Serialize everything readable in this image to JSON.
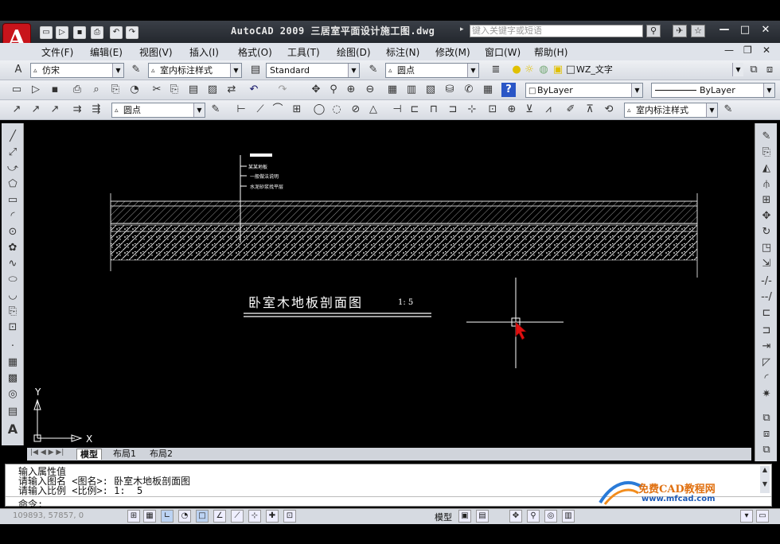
{
  "window": {
    "title": "AutoCAD 2009  三居室平面设计施工图.dwg",
    "search_placeholder": "键入关键字或短语",
    "minimize": "—",
    "restore": "□",
    "close": "✕"
  },
  "app_button": {
    "label": "A"
  },
  "menu": {
    "items": [
      "文件(F)",
      "编辑(E)",
      "视图(V)",
      "插入(I)",
      "格式(O)",
      "工具(T)",
      "绘图(D)",
      "标注(N)",
      "修改(M)",
      "窗口(W)",
      "帮助(H)"
    ]
  },
  "toolbar1": {
    "text_style": "仿宋",
    "dim_style": "室内标注样式",
    "table_style": "Standard",
    "multileader_style": "圆点",
    "layer": "WZ_文字"
  },
  "toolbar2": {
    "color": "ByLayer",
    "linetype": "ByLayer"
  },
  "toolbar3": {
    "multileader_style": "圆点",
    "dim_style": "室内标注样式"
  },
  "drawing": {
    "title": "卧室木地板剖面图",
    "scale": "1:  5",
    "leader_notes": [
      "某某地板",
      "一般做法说明",
      "水泥砂浆找平层"
    ],
    "ucs_x": "X",
    "ucs_y": "Y"
  },
  "tabs": {
    "model": "模型",
    "layout1": "布局1",
    "layout2": "布局2"
  },
  "command": {
    "lines": [
      "输入属性值",
      "请输入图名 <图名>: 卧室木地板剖面图",
      "请输入比例 <比例>: 1:  5"
    ],
    "prompt": "命令:"
  },
  "status": {
    "coords": "109893, 57857, 0",
    "model_label": "模型"
  },
  "watermark": {
    "site_cn": "免费CAD教程网",
    "site_url": "www.mfcad.com"
  },
  "colors": {
    "accent": "#c8141b",
    "canvas": "#000000",
    "crosshair": "#ffffff",
    "cursor": "#e01010"
  }
}
